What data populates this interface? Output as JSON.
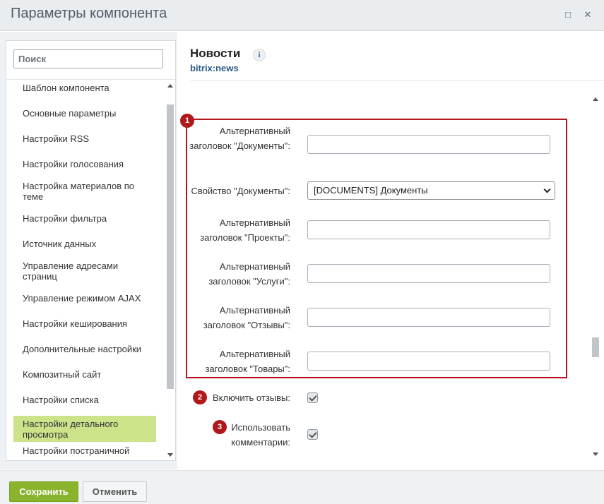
{
  "window": {
    "title": "Параметры компонента",
    "maximize_icon": "□",
    "close_icon": "✕"
  },
  "sidebar": {
    "search_placeholder": "Поиск",
    "items": [
      {
        "label": "Шаблон компонента"
      },
      {
        "label": "Основные параметры"
      },
      {
        "label": "Настройки RSS"
      },
      {
        "label": "Настройки голосования"
      },
      {
        "label": "Настройка материалов по теме"
      },
      {
        "label": "Настройки фильтра"
      },
      {
        "label": "Источник данных"
      },
      {
        "label": "Управление адресами страниц"
      },
      {
        "label": "Управление режимом AJAX"
      },
      {
        "label": "Настройки кеширования"
      },
      {
        "label": "Дополнительные настройки"
      },
      {
        "label": "Композитный сайт"
      },
      {
        "label": "Настройки списка"
      },
      {
        "label": "Настройки детального просмотра",
        "active": true
      },
      {
        "label": "Настройки постраничной"
      }
    ]
  },
  "main": {
    "title": "Новости",
    "info_icon": "i",
    "subtitle": "bitrix:news",
    "badges": [
      "1",
      "2",
      "3"
    ],
    "fields": {
      "alt_docs_label": "Альтернативный заголовок \"Документы\":",
      "docs_prop_label": "Свойство \"Документы\":",
      "docs_prop_value": "[DOCUMENTS] Документы",
      "alt_projects_label": "Альтернативный заголовок \"Проекты\":",
      "alt_services_label": "Альтернативный заголовок \"Услуги\":",
      "alt_reviews_label": "Альтернативный заголовок \"Отзывы\":",
      "alt_products_label": "Альтернативный заголовок \"Товары\":",
      "enable_reviews_label": "Включить отзывы:",
      "enable_reviews_checked": true,
      "use_comments_label": "Использовать комментарии:",
      "use_comments_checked": true
    }
  },
  "footer": {
    "save_label": "Сохранить",
    "cancel_label": "Отменить"
  },
  "colors": {
    "accent_green": "#8bb42e",
    "active_item": "#cde38a",
    "highlight_red": "#b0181c",
    "link_blue": "#2a5b86"
  }
}
